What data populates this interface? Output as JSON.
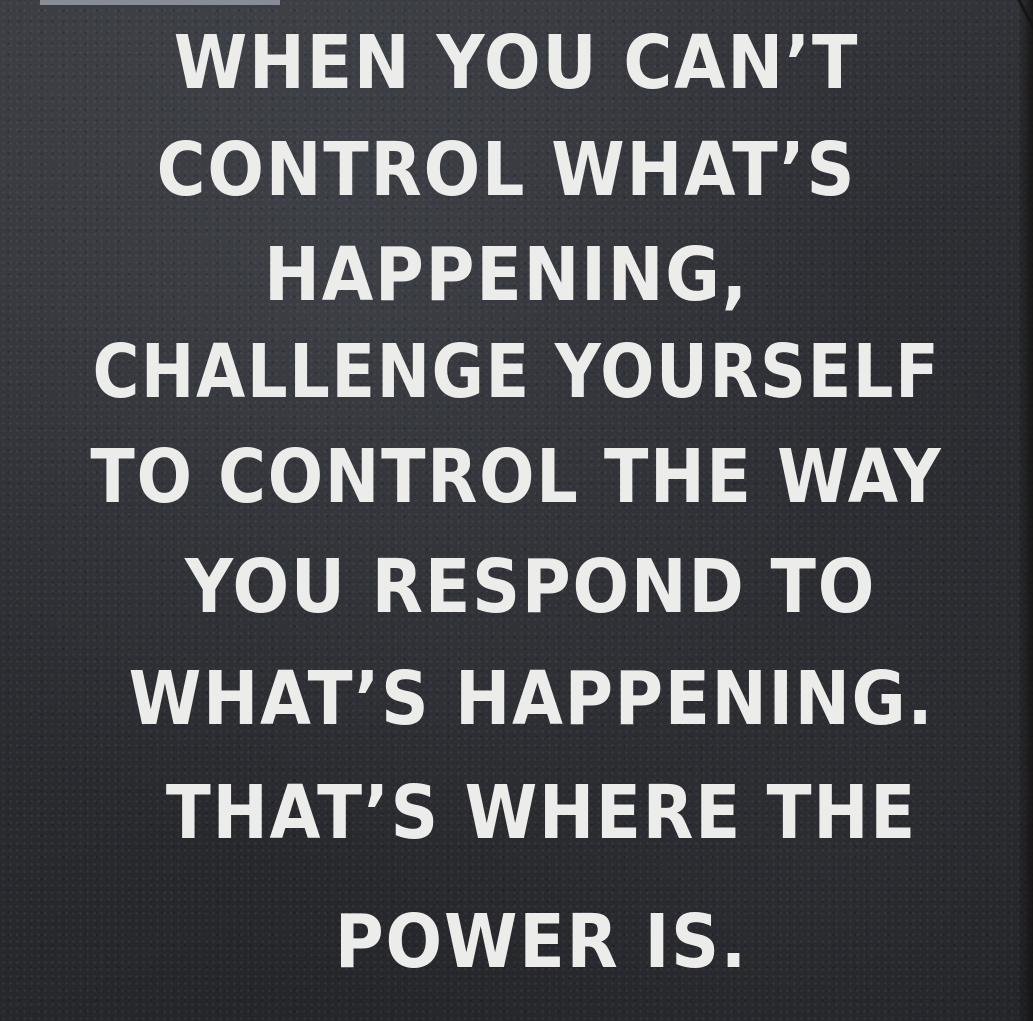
{
  "quote": {
    "lines": [
      "WHEN YOU CAN’T",
      "CONTROL WHAT’S",
      "HAPPENING,",
      "CHALLENGE YOURSELF",
      "TO CONTROL THE WAY",
      "YOU RESPOND TO",
      "WHAT’S HAPPENING.",
      "THAT’S WHERE THE",
      "POWER IS."
    ]
  },
  "colors": {
    "background": "#2c2e33",
    "text": "#ecedea"
  }
}
